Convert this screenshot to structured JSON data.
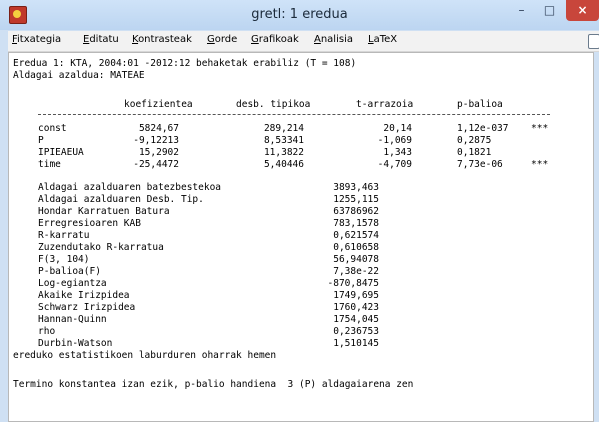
{
  "window": {
    "title": "gretl: 1 eredua",
    "min": "–",
    "max": "□",
    "close": "×"
  },
  "menu": [
    "Fitxategia",
    "Editatu",
    "Kontrasteak",
    "Gorde",
    "Grafikoak",
    "Analisia",
    "LaTeX"
  ],
  "output": {
    "line1": "Eredua 1: KTA, 2004:01 -2012:12 behaketak erabiliz (T = 108)",
    "line2": "Aldagai azaldua: MATEAE",
    "headers": [
      "koefizientea",
      "desb. tipikoa",
      "t-arrazoia",
      "p-balioa"
    ],
    "rows": [
      {
        "name": "const",
        "coef": "5824,67",
        "se": "289,214",
        "t": "20,14",
        "p": "1,12e-037",
        "stars": "***"
      },
      {
        "name": "P",
        "coef": "-9,12213",
        "se": "8,53341",
        "t": "-1,069",
        "p": "0,2875",
        "stars": ""
      },
      {
        "name": "IPIEAEUA",
        "coef": "15,2902",
        "se": "11,3822",
        "t": "1,343",
        "p": "0,1821",
        "stars": ""
      },
      {
        "name": "time",
        "coef": "-25,4472",
        "se": "5,40446",
        "t": "-4,709",
        "p": "7,73e-06",
        "stars": "***"
      }
    ],
    "stats": [
      {
        "label": "Aldagai azalduaren batezbestekoa",
        "value": "3893,463"
      },
      {
        "label": "Aldagai azalduaren Desb. Tip.",
        "value": "1255,115"
      },
      {
        "label": "Hondar Karratuen Batura",
        "value": "63786962"
      },
      {
        "label": "Erregresioaren KAB",
        "value": "783,1578"
      },
      {
        "label": "R-karratu",
        "value": "0,621574"
      },
      {
        "label": "Zuzendutako R-karratua",
        "value": "0,610658"
      },
      {
        "label": "F(3, 104)",
        "value": "56,94078"
      },
      {
        "label": "P-balioa(F)",
        "value": "7,38e-22"
      },
      {
        "label": "Log-egiantza",
        "value": "-870,8475"
      },
      {
        "label": "Akaike Irizpidea",
        "value": "1749,695"
      },
      {
        "label": "Schwarz Irizpidea",
        "value": "1760,423"
      },
      {
        "label": "Hannan-Quinn",
        "value": "1754,045"
      },
      {
        "label": "rho",
        "value": "0,236753"
      },
      {
        "label": "Durbin-Watson",
        "value": "1,510145"
      }
    ],
    "note": "ereduko estatistikoen laburduren oharrak hemen",
    "final": "Termino konstantea izan ezik, p-balio handiena  3 (P) aldagaiarena zen"
  }
}
